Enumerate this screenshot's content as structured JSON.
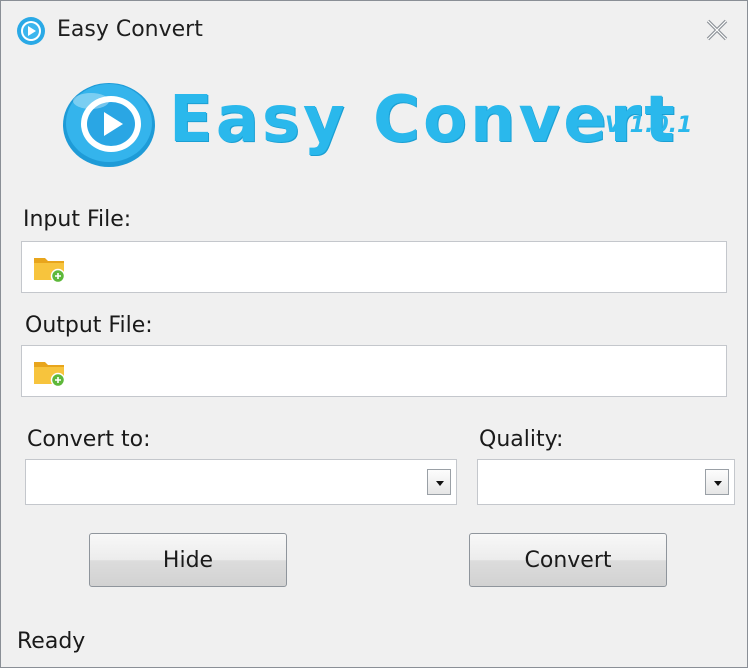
{
  "window": {
    "title": "Easy Convert"
  },
  "logo": {
    "name": "Easy Convert",
    "version": "V 1.0.1"
  },
  "input_file": {
    "label": "Input File:",
    "value": ""
  },
  "output_file": {
    "label": "Output File:",
    "value": ""
  },
  "convert_to": {
    "label": "Convert to:",
    "selected": ""
  },
  "quality": {
    "label": "Quality:",
    "selected": ""
  },
  "buttons": {
    "hide": "Hide",
    "convert": "Convert"
  },
  "status": "Ready",
  "colors": {
    "brand": "#2ab8ec",
    "window_bg": "#f0f0f0",
    "field_border": "#c4c7cc"
  }
}
